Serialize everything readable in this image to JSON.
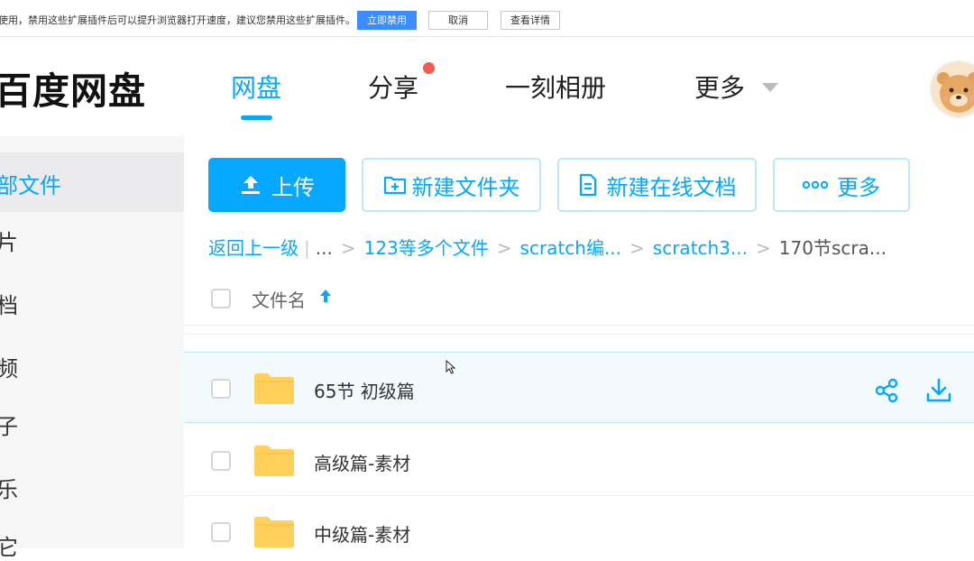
{
  "notice": {
    "message": "使用，禁用这些扩展插件后可以提升浏览器打开速度，建议您禁用这些扩展插件。",
    "disable_now": "立即禁用",
    "cancel": "取消",
    "view_details": "查看详情"
  },
  "header": {
    "logo": "百度网盘",
    "nav": [
      "网盘",
      "分享",
      "一刻相册",
      "更多"
    ],
    "active_nav": "网盘"
  },
  "sidebar": {
    "items": [
      "部文件",
      "片",
      "档",
      "频",
      "子",
      "乐",
      "它"
    ],
    "active": "部文件"
  },
  "toolbar": {
    "upload": "上传",
    "new_folder": "新建文件夹",
    "new_online_doc": "新建在线文档",
    "more": "更多"
  },
  "breadcrumb": {
    "back": "返回上一级",
    "ellipsis": "...",
    "items": [
      "123等多个文件",
      "scratch编...",
      "scratch3...",
      "170节scra..."
    ]
  },
  "file_list": {
    "column_name": "文件名",
    "rows": [
      {
        "name": ""
      },
      {
        "name": "65节 初级篇"
      },
      {
        "name": "高级篇-素材"
      },
      {
        "name": "中级篇-素材"
      }
    ]
  },
  "colors": {
    "accent": "#06a7ff",
    "folder": "#ffd15c",
    "badge": "#f35b4f"
  }
}
